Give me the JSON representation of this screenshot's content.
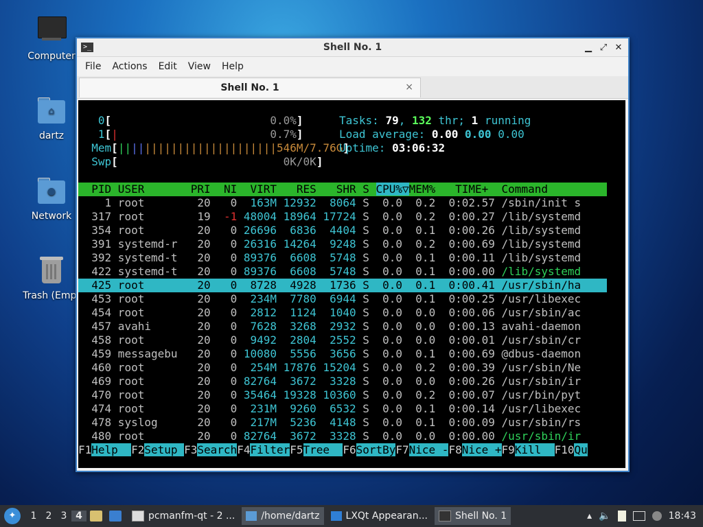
{
  "desktop": {
    "icons": [
      {
        "label": "Computer"
      },
      {
        "label": "dartz"
      },
      {
        "label": "Network"
      },
      {
        "label": "Trash (Empt"
      }
    ]
  },
  "window": {
    "title": "Shell No. 1",
    "menu": [
      "File",
      "Actions",
      "Edit",
      "View",
      "Help"
    ],
    "tab_label": "Shell No. 1",
    "close_glyph": "×"
  },
  "htop": {
    "meters": {
      "cpu0_label": "0",
      "cpu0_value": "0.0%",
      "cpu1_label": "1",
      "cpu1_value": "0.7%",
      "mem_label": "Mem",
      "mem_bars": "||||||||||||||||||||",
      "mem_value": "546M/7.76G",
      "swp_label": "Swp",
      "swp_value": "0K/0K"
    },
    "summary": {
      "tasks_label": "Tasks: ",
      "tasks": "79",
      "thr": "132",
      "thr_label": " thr; ",
      "running": "1",
      "running_label": " running",
      "load_label": "Load average: ",
      "load1": "0.00",
      "load5": "0.00",
      "load15": "0.00",
      "uptime_label": "Uptime: ",
      "uptime": "03:06:32"
    },
    "header": {
      "pid": "  PID",
      "user": " USER     ",
      "pri": "  PRI",
      "ni": "  NI",
      "virt": "  VIRT",
      "res": "   RES",
      "shr": "   SHR",
      "s": " S ",
      "cpu": "CPU%▽",
      "mem": "MEM%",
      "time": "   TIME+ ",
      "command": " Command"
    },
    "rows": [
      {
        "pid": "1",
        "user": "root",
        "pri": "20",
        "ni": "0",
        "virt": "163M",
        "res": "12932",
        "shr": "8064",
        "s": "S",
        "cpu": "0.0",
        "mem": "0.2",
        "time": "0:02.57",
        "cmd": "/sbin/init s",
        "cmd_color": "default"
      },
      {
        "pid": "317",
        "user": "root",
        "pri": "19",
        "ni": "-1",
        "virt": "48004",
        "res": "18964",
        "shr": "17724",
        "s": "S",
        "cpu": "0.0",
        "mem": "0.2",
        "time": "0:00.27",
        "cmd": "/lib/systemd",
        "cmd_color": "default"
      },
      {
        "pid": "354",
        "user": "root",
        "pri": "20",
        "ni": "0",
        "virt": "26696",
        "res": "6836",
        "shr": "4404",
        "s": "S",
        "cpu": "0.0",
        "mem": "0.1",
        "time": "0:00.26",
        "cmd": "/lib/systemd",
        "cmd_color": "default"
      },
      {
        "pid": "391",
        "user": "systemd-r",
        "pri": "20",
        "ni": "0",
        "virt": "26316",
        "res": "14264",
        "shr": "9248",
        "s": "S",
        "cpu": "0.0",
        "mem": "0.2",
        "time": "0:00.69",
        "cmd": "/lib/systemd",
        "cmd_color": "default"
      },
      {
        "pid": "392",
        "user": "systemd-t",
        "pri": "20",
        "ni": "0",
        "virt": "89376",
        "res": "6608",
        "shr": "5748",
        "s": "S",
        "cpu": "0.0",
        "mem": "0.1",
        "time": "0:00.11",
        "cmd": "/lib/systemd",
        "cmd_color": "default"
      },
      {
        "pid": "422",
        "user": "systemd-t",
        "pri": "20",
        "ni": "0",
        "virt": "89376",
        "res": "6608",
        "shr": "5748",
        "s": "S",
        "cpu": "0.0",
        "mem": "0.1",
        "time": "0:00.00",
        "cmd": "/lib/systemd",
        "cmd_color": "green"
      },
      {
        "pid": "425",
        "user": "root",
        "pri": "20",
        "ni": "0",
        "virt": "8728",
        "res": "4928",
        "shr": "1736",
        "s": "S",
        "cpu": "0.0",
        "mem": "0.1",
        "time": "0:00.41",
        "cmd": "/usr/sbin/ha",
        "cmd_color": "selected"
      },
      {
        "pid": "453",
        "user": "root",
        "pri": "20",
        "ni": "0",
        "virt": "234M",
        "res": "7780",
        "shr": "6944",
        "s": "S",
        "cpu": "0.0",
        "mem": "0.1",
        "time": "0:00.25",
        "cmd": "/usr/libexec",
        "cmd_color": "default"
      },
      {
        "pid": "454",
        "user": "root",
        "pri": "20",
        "ni": "0",
        "virt": "2812",
        "res": "1124",
        "shr": "1040",
        "s": "S",
        "cpu": "0.0",
        "mem": "0.0",
        "time": "0:00.06",
        "cmd": "/usr/sbin/ac",
        "cmd_color": "default"
      },
      {
        "pid": "457",
        "user": "avahi",
        "pri": "20",
        "ni": "0",
        "virt": "7628",
        "res": "3268",
        "shr": "2932",
        "s": "S",
        "cpu": "0.0",
        "mem": "0.0",
        "time": "0:00.13",
        "cmd": "avahi-daemon",
        "cmd_color": "default"
      },
      {
        "pid": "458",
        "user": "root",
        "pri": "20",
        "ni": "0",
        "virt": "9492",
        "res": "2804",
        "shr": "2552",
        "s": "S",
        "cpu": "0.0",
        "mem": "0.0",
        "time": "0:00.01",
        "cmd": "/usr/sbin/cr",
        "cmd_color": "default"
      },
      {
        "pid": "459",
        "user": "messagebu",
        "pri": "20",
        "ni": "0",
        "virt": "10080",
        "res": "5556",
        "shr": "3656",
        "s": "S",
        "cpu": "0.0",
        "mem": "0.1",
        "time": "0:00.69",
        "cmd": "@dbus-daemon",
        "cmd_color": "default"
      },
      {
        "pid": "460",
        "user": "root",
        "pri": "20",
        "ni": "0",
        "virt": "254M",
        "res": "17876",
        "shr": "15204",
        "s": "S",
        "cpu": "0.0",
        "mem": "0.2",
        "time": "0:00.39",
        "cmd": "/usr/sbin/Ne",
        "cmd_color": "default"
      },
      {
        "pid": "469",
        "user": "root",
        "pri": "20",
        "ni": "0",
        "virt": "82764",
        "res": "3672",
        "shr": "3328",
        "s": "S",
        "cpu": "0.0",
        "mem": "0.0",
        "time": "0:00.26",
        "cmd": "/usr/sbin/ir",
        "cmd_color": "default"
      },
      {
        "pid": "470",
        "user": "root",
        "pri": "20",
        "ni": "0",
        "virt": "35464",
        "res": "19328",
        "shr": "10360",
        "s": "S",
        "cpu": "0.0",
        "mem": "0.2",
        "time": "0:00.07",
        "cmd": "/usr/bin/pyt",
        "cmd_color": "default"
      },
      {
        "pid": "474",
        "user": "root",
        "pri": "20",
        "ni": "0",
        "virt": "231M",
        "res": "9260",
        "shr": "6532",
        "s": "S",
        "cpu": "0.0",
        "mem": "0.1",
        "time": "0:00.14",
        "cmd": "/usr/libexec",
        "cmd_color": "default"
      },
      {
        "pid": "478",
        "user": "syslog",
        "pri": "20",
        "ni": "0",
        "virt": "217M",
        "res": "5236",
        "shr": "4148",
        "s": "S",
        "cpu": "0.0",
        "mem": "0.1",
        "time": "0:00.09",
        "cmd": "/usr/sbin/rs",
        "cmd_color": "default"
      },
      {
        "pid": "480",
        "user": "root",
        "pri": "20",
        "ni": "0",
        "virt": "82764",
        "res": "3672",
        "shr": "3328",
        "s": "S",
        "cpu": "0.0",
        "mem": "0.0",
        "time": "0:00.00",
        "cmd": "/usr/sbin/ir",
        "cmd_color": "green"
      }
    ],
    "fkeys": [
      {
        "key": "F1",
        "label": "Help  "
      },
      {
        "key": "F2",
        "label": "Setup "
      },
      {
        "key": "F3",
        "label": "Search"
      },
      {
        "key": "F4",
        "label": "Filter"
      },
      {
        "key": "F5",
        "label": "Tree  "
      },
      {
        "key": "F6",
        "label": "SortBy"
      },
      {
        "key": "F7",
        "label": "Nice -"
      },
      {
        "key": "F8",
        "label": "Nice +"
      },
      {
        "key": "F9",
        "label": "Kill  "
      },
      {
        "key": "F10",
        "label": "Qu"
      }
    ]
  },
  "taskbar": {
    "desktops": [
      "1",
      "2",
      "3",
      "4"
    ],
    "active_desktop": "4",
    "tasks": [
      {
        "label": "pcmanfm-qt - 2 ..."
      },
      {
        "label": "/home/dartz"
      },
      {
        "label": "LXQt Appearan..."
      },
      {
        "label": "Shell No. 1"
      }
    ],
    "clock": "18:43"
  },
  "colors": {
    "accent": "#3e82c8",
    "htop_header": "#2bb52b",
    "htop_selection": "#2fb7c4"
  }
}
